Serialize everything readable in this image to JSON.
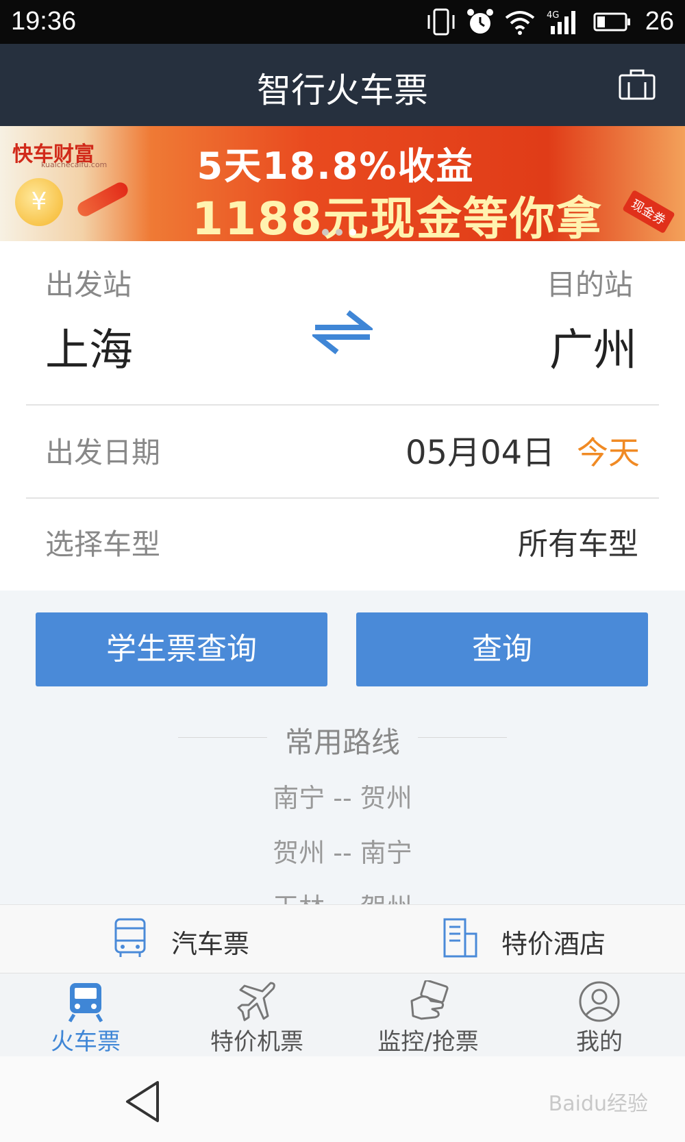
{
  "status_bar": {
    "time": "19:36",
    "battery": "26",
    "network": "4G"
  },
  "header": {
    "title": "智行火车票"
  },
  "banner": {
    "brand": "快车财富",
    "brand_sub": "kuaichecaifu.com",
    "coin_symbol": "¥",
    "line1": "5天18.8%收益",
    "line2": "1188元现金等你拿",
    "tag": "现金券"
  },
  "form": {
    "from_label": "出发站",
    "from_value": "上海",
    "to_label": "目的站",
    "to_value": "广州",
    "date_label": "出发日期",
    "date_value": "05月04日",
    "date_hint": "今天",
    "type_label": "选择车型",
    "type_value": "所有车型"
  },
  "buttons": {
    "student": "学生票查询",
    "search": "查询"
  },
  "routes": {
    "title": "常用路线",
    "items": [
      "南宁 -- 贺州",
      "贺州 -- 南宁",
      "玉林 -- 贺州"
    ]
  },
  "links": {
    "bus": "汽车票",
    "hotel": "特价酒店"
  },
  "tabs": [
    "火车票",
    "特价机票",
    "监控/抢票",
    "我的"
  ],
  "watermark": "Baidu经验",
  "colors": {
    "accent": "#4a8ad8",
    "header": "#26303e",
    "today": "#f08a24"
  }
}
